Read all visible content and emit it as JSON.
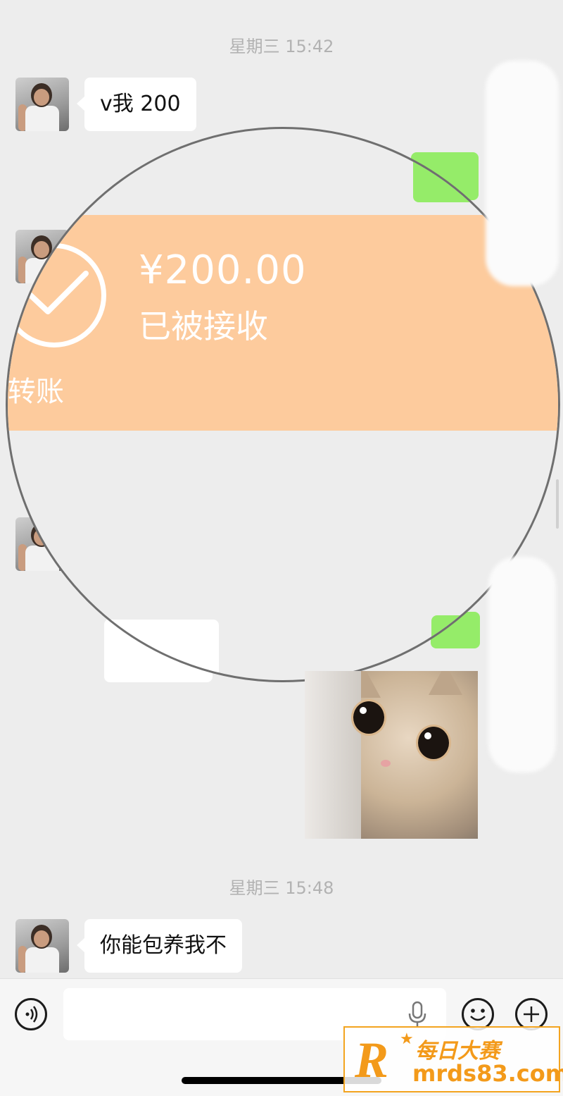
{
  "chat": {
    "time1": "星期三 15:42",
    "msg1": "v我 200",
    "time2": "星期三 15:48",
    "msg2": "你能包养我不"
  },
  "transfer": {
    "amount": "¥200.00",
    "status": "已被接收",
    "label": "转账"
  },
  "watermark": {
    "line1": "每日大赛",
    "line2": "mrds83.com"
  },
  "icons": {
    "voice": "voice-icon",
    "mic": "mic-icon",
    "emoji": "emoji-icon",
    "plus": "plus-icon"
  },
  "colors": {
    "transfer_band": "#fdcb9d",
    "self_bubble": "#95ec69",
    "background": "#ededed",
    "watermark": "#f39a1a"
  }
}
